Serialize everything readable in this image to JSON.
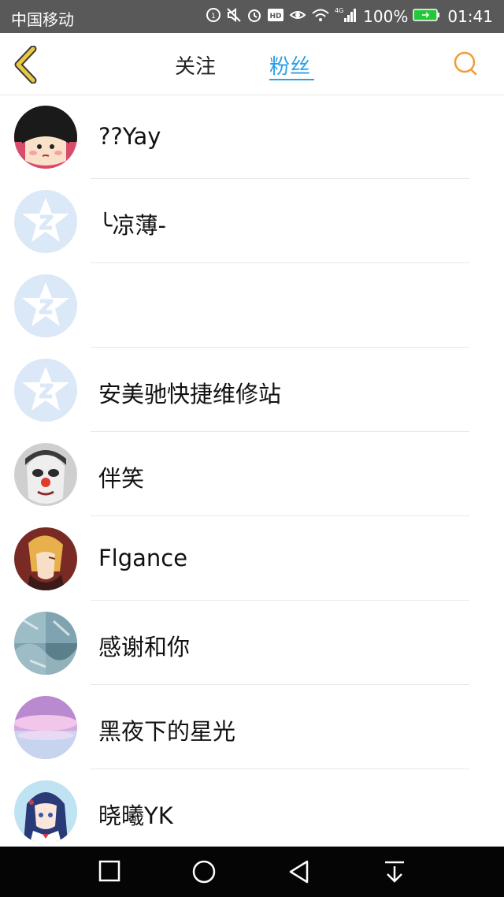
{
  "status_bar": {
    "carrier": "中国移动",
    "network": "4G",
    "battery_percent": "100%",
    "time": "01:41",
    "icons": [
      "data-saver-icon",
      "mute-icon",
      "alarm-icon",
      "hd-icon",
      "eye-comfort-icon",
      "wifi-icon",
      "signal-icon",
      "battery-icon"
    ],
    "battery_color": "#25c73a"
  },
  "header": {
    "back_icon": "back-chevron-icon",
    "tabs": [
      {
        "label": "关注",
        "active": false
      },
      {
        "label": "粉丝",
        "active": true
      }
    ],
    "search_icon": "search-icon",
    "accent_color": "#2aa0e6",
    "back_color": "#e9c93f",
    "search_color": "#f39a3a"
  },
  "fans": [
    {
      "name": "??Yay",
      "avatar": "cartoon-girl-avatar"
    },
    {
      "name": "╰凉薄-",
      "avatar": "default-qq-avatar"
    },
    {
      "name": "",
      "avatar": "default-qq-avatar"
    },
    {
      "name": "安美驰快捷维修站",
      "avatar": "default-qq-avatar"
    },
    {
      "name": "伴笑",
      "avatar": "clown-face-avatar"
    },
    {
      "name": "Flgance",
      "avatar": "anime-character-avatar"
    },
    {
      "name": "感谢和你",
      "avatar": "abstract-blue-avatar"
    },
    {
      "name": "黑夜下的星光",
      "avatar": "pink-sky-avatar"
    },
    {
      "name": "晓曦YK",
      "avatar": "anime-girl-avatar"
    }
  ],
  "nav_bar": {
    "icons": [
      "recent-apps-icon",
      "home-icon",
      "back-icon",
      "notification-pull-icon"
    ]
  }
}
